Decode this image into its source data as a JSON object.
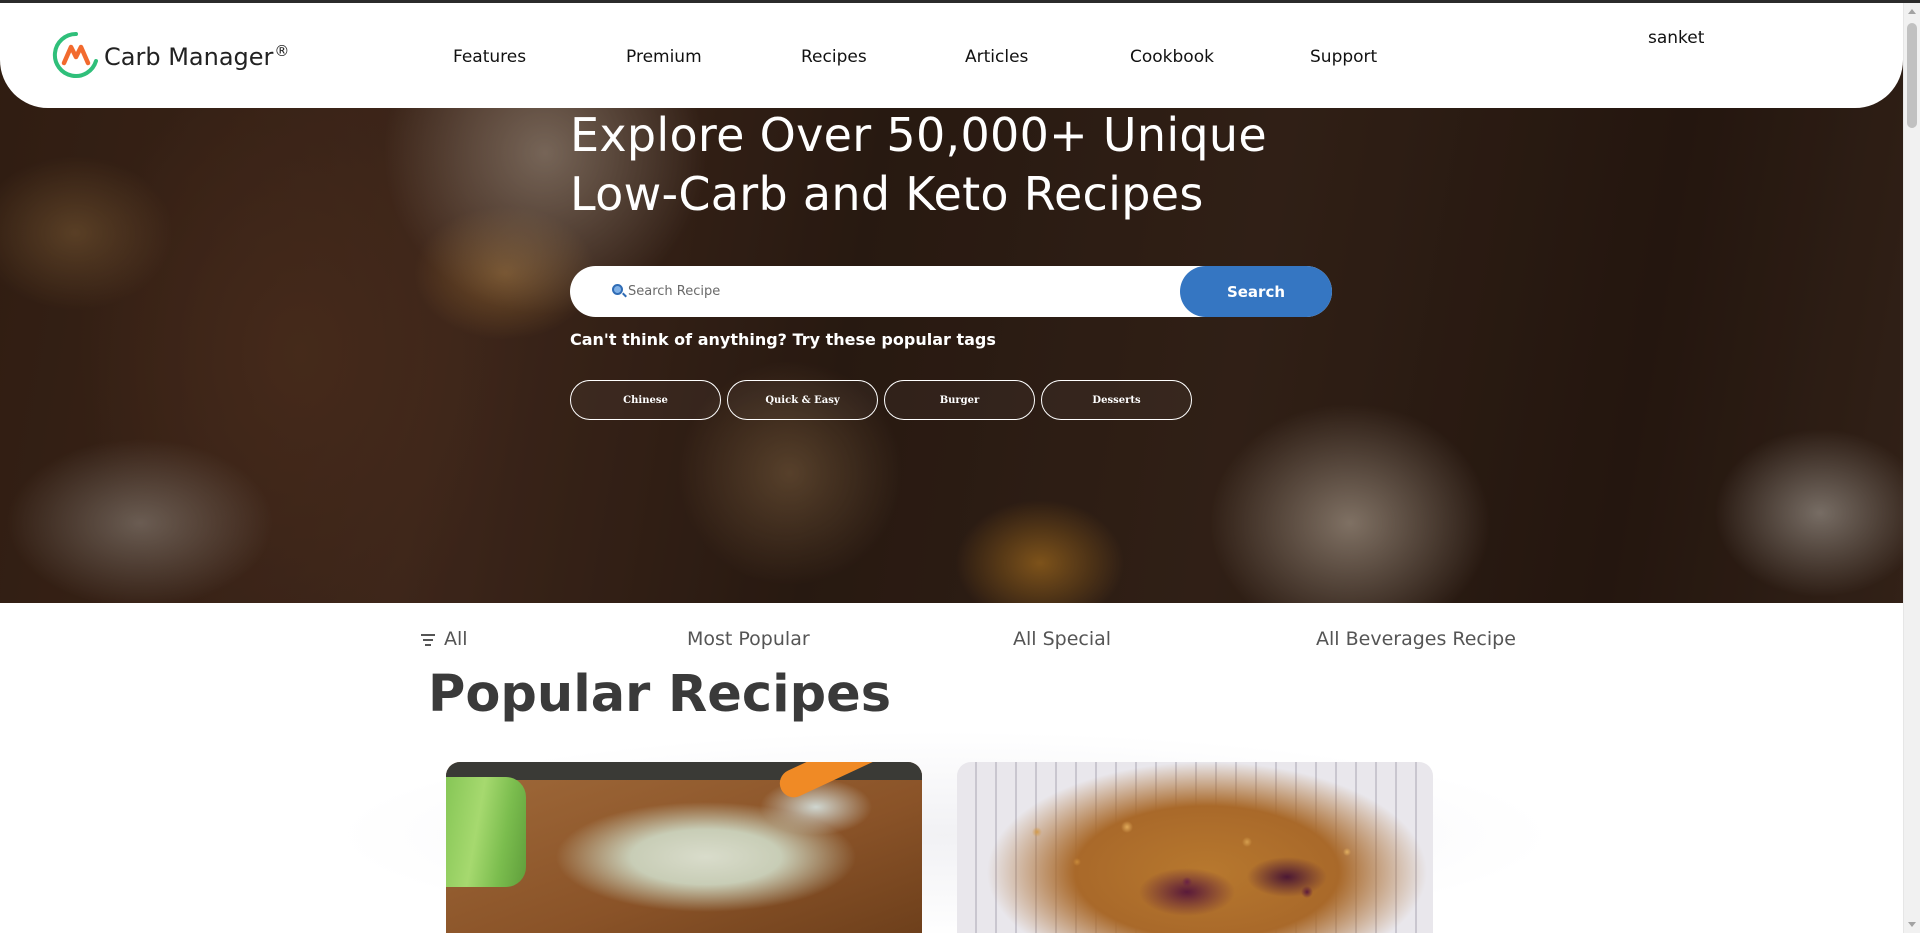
{
  "header": {
    "brand": "Carb Manager",
    "brand_mark": "®",
    "nav": [
      "Features",
      "Premium",
      "Recipes",
      "Articles",
      "Cookbook",
      "Support"
    ],
    "user": "sanket"
  },
  "hero": {
    "title": "Explore Over 50,000+ Unique Low-Carb and Keto Recipes",
    "search_placeholder": "Search Recipe",
    "search_button": "Search",
    "tags_hint": "Can't think of anything? Try these popular tags",
    "tags": [
      "Chinese",
      "Quick & Easy",
      "Burger",
      "Desserts"
    ]
  },
  "filters": [
    "All",
    "Most Popular",
    "All Special",
    "All Beverages Recipe"
  ],
  "section_title": "Popular Recipes",
  "colors": {
    "accent": "#3576c2",
    "logo_green": "#2fbf7a",
    "logo_orange": "#f26a2e"
  },
  "icons": [
    "logo-icon",
    "search-icon",
    "filter-icon"
  ]
}
